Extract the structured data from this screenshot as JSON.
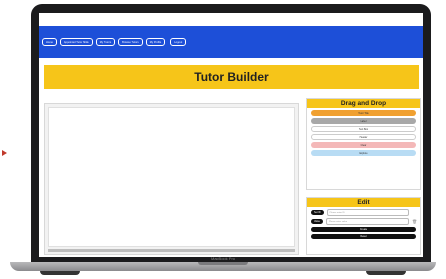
{
  "nav": {
    "items": [
      "Home",
      "Appointed Tutor Slide",
      "My Tutors",
      "Browse Tutors",
      "My Profile",
      "Logout"
    ]
  },
  "banner": {
    "title": "Tutor Builder"
  },
  "dnd": {
    "title": "Drag and Drop",
    "items": [
      {
        "label": "Tutor Title",
        "color": "#f0a030"
      },
      {
        "label": "Label",
        "color": "#a8a8a8"
      },
      {
        "label": "Text Box",
        "color": "#ffffff"
      },
      {
        "label": "Header",
        "color": "#ffffff"
      },
      {
        "label": "Clear",
        "color": "#f4b8b8"
      },
      {
        "label": "Explore",
        "color": "#b8dcf4"
      }
    ]
  },
  "edit": {
    "title": "Edit",
    "field1_label": "Set ID",
    "field1_placeholder": "Please enter ID",
    "field2_label": "Value",
    "field2_placeholder": "Please enter value",
    "create_label": "Create",
    "reset_label": "Reset"
  },
  "device": {
    "label": "MacBook Pro"
  },
  "colors": {
    "nav": "#1d4fd8",
    "accent": "#f6c519",
    "bezel": "#1b1b1d"
  }
}
